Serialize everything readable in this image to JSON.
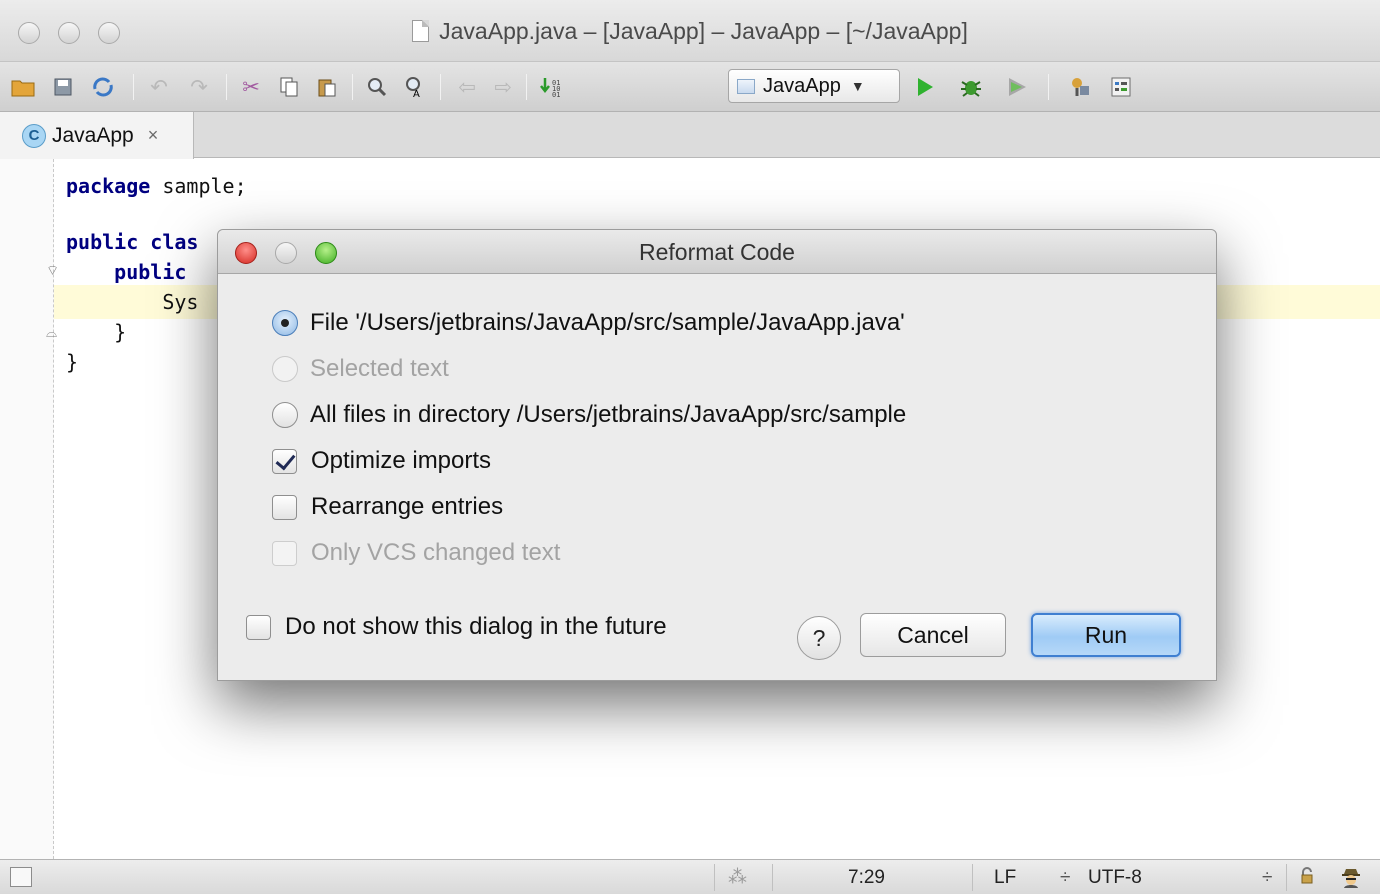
{
  "window": {
    "title": "JavaApp.java – [JavaApp] – JavaApp – [~/JavaApp]"
  },
  "toolbar": {
    "icons": [
      "open-folder-icon",
      "save-icon",
      "sync-icon",
      "undo-icon",
      "redo-icon",
      "cut-icon",
      "copy-icon",
      "paste-icon",
      "find-icon",
      "replace-icon",
      "back-icon",
      "forward-icon",
      "make-project-icon",
      "run-icon",
      "debug-icon",
      "coverage-icon",
      "project-structure-icon",
      "sdk-icon"
    ],
    "run_config_label": "JavaApp"
  },
  "tabs": [
    {
      "label": "JavaApp",
      "icon": "class-icon",
      "close": "×"
    }
  ],
  "editor": {
    "lines": [
      {
        "kw": "package",
        "rest": " sample;"
      },
      {
        "kw": "",
        "rest": ""
      },
      {
        "kw": "public clas",
        "rest": ""
      },
      {
        "indent": "    ",
        "kw": "public",
        "rest": ""
      },
      {
        "indent": "        ",
        "kw": "",
        "rest": "Sys"
      },
      {
        "indent": "    ",
        "kw": "",
        "rest": "}"
      },
      {
        "kw": "",
        "rest": "}"
      }
    ]
  },
  "dialog": {
    "title": "Reformat Code",
    "options": [
      {
        "type": "radio",
        "label": "File '/Users/jetbrains/JavaApp/src/sample/JavaApp.java'",
        "checked": true,
        "enabled": true
      },
      {
        "type": "radio",
        "label": "Selected text",
        "checked": false,
        "enabled": false
      },
      {
        "type": "radio",
        "label": "All files in directory /Users/jetbrains/JavaApp/src/sample",
        "checked": false,
        "enabled": true
      },
      {
        "type": "checkbox",
        "label": "Optimize imports",
        "checked": true,
        "enabled": true
      },
      {
        "type": "checkbox",
        "label": "Rearrange entries",
        "checked": false,
        "enabled": true
      },
      {
        "type": "checkbox",
        "label": "Only VCS changed text",
        "checked": false,
        "enabled": false
      }
    ],
    "dont_show_label": "Do not show this dialog in the future",
    "help_label": "?",
    "cancel_label": "Cancel",
    "run_label": "Run"
  },
  "statusbar": {
    "position": "7:29",
    "line_separator": "LF",
    "encoding": "UTF-8",
    "spinner": "⁂",
    "updown": "÷"
  }
}
